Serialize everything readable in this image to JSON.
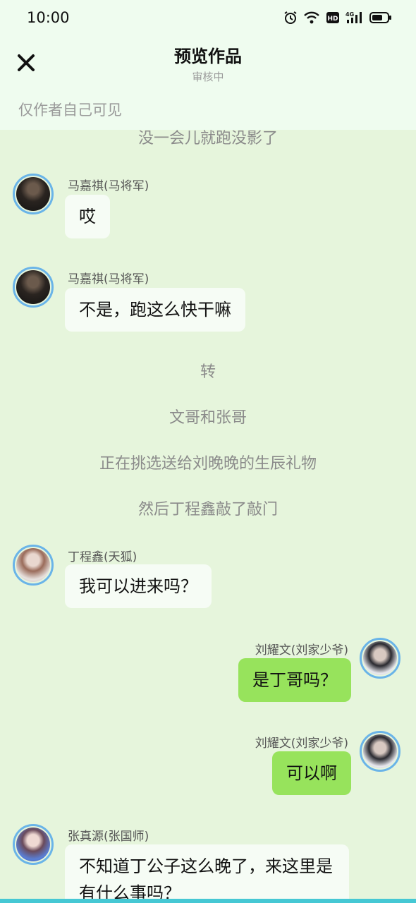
{
  "status_bar": {
    "time": "10:00",
    "icons": [
      "alarm-icon",
      "wifi-icon",
      "hd-icon",
      "signal-4g-icon",
      "battery-icon"
    ]
  },
  "header": {
    "title": "预览作品",
    "subtitle": "审核中",
    "visibility_note": "仅作者自己可见"
  },
  "chat": {
    "narration_1": "没一会儿就跑没影了",
    "msg_1": {
      "name": "马嘉祺(马将军)",
      "text": "哎"
    },
    "msg_2": {
      "name": "马嘉祺(马将军)",
      "text": "不是，跑这么快干嘛"
    },
    "narration_2": "转",
    "narration_3": "文哥和张哥",
    "narration_4": "正在挑选送给刘晚晚的生辰礼物",
    "narration_5": "然后丁程鑫敲了敲门",
    "msg_3": {
      "name": "丁程鑫(天狐)",
      "text": "我可以进来吗？"
    },
    "msg_4": {
      "name": "刘耀文(刘家少爷)",
      "text": "是丁哥吗？"
    },
    "msg_5": {
      "name": "刘耀文(刘家少爷)",
      "text": "可以啊"
    },
    "msg_6": {
      "name": "张真源(张国师)",
      "text": "不知道丁公子这么晚了，来这里是有什么事吗？"
    }
  },
  "colors": {
    "header_bg": "#effcef",
    "chat_bg": "#e6f5dc",
    "left_bubble": "#f6fcf5",
    "right_bubble": "#97e35c",
    "avatar_ring": "#6ab4e8"
  }
}
